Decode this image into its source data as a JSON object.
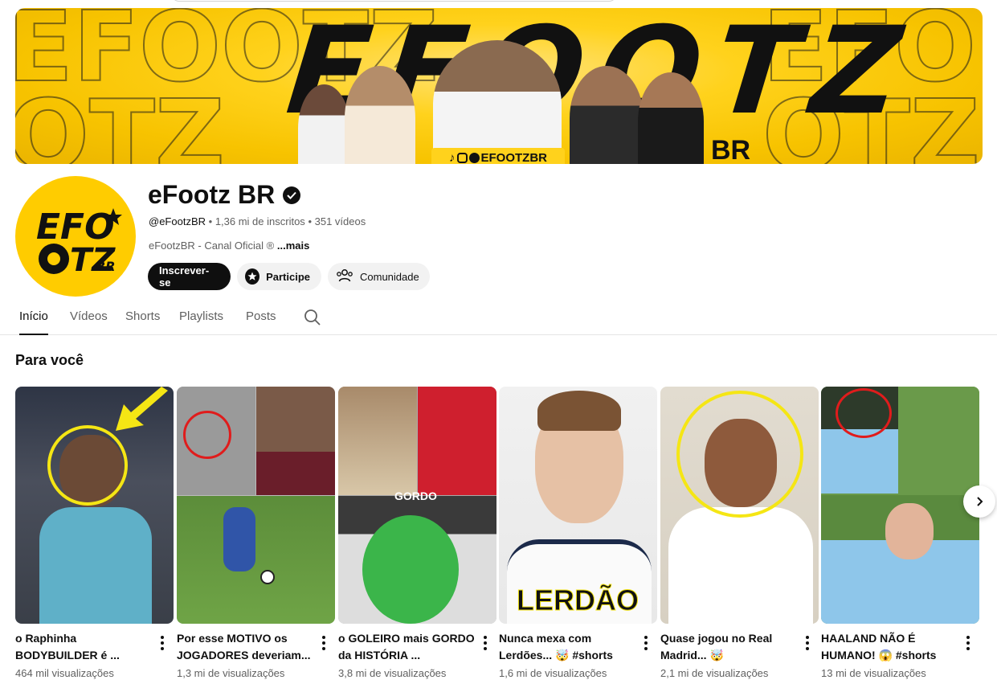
{
  "banner": {
    "title": "EFOOTZ",
    "subtitle": "BR",
    "social_handle": "EFOOTZBR",
    "bg_text": "EFOOTZ"
  },
  "channel": {
    "name": "eFootz BR",
    "handle": "@eFootzBR",
    "subscribers": "1,36 mi de inscritos",
    "videos": "351 vídeos",
    "separator": "•",
    "description": "eFootzBR - Canal Oficial ®",
    "more_label": "...mais",
    "avatar_text_1": "EFO",
    "avatar_text_2": "TZ",
    "avatar_text_3": "BR"
  },
  "actions": {
    "subscribe": "Inscrever-se",
    "join": "Participe",
    "community": "Comunidade"
  },
  "tabs": [
    {
      "label": "Início"
    },
    {
      "label": "Vídeos"
    },
    {
      "label": "Shorts"
    },
    {
      "label": "Playlists"
    },
    {
      "label": "Posts"
    }
  ],
  "section": {
    "title": "Para você"
  },
  "videos": [
    {
      "title": "o Raphinha BODYBUILDER é ...",
      "views": "464 mil visualizações"
    },
    {
      "title": "Por esse MOTIVO os JOGADORES deveriam...",
      "views": "1,3 mi de visualizações"
    },
    {
      "title": "o GOLEIRO mais GORDO da HISTÓRIA ...",
      "views": "3,8 mi de visualizações",
      "overlay": "GORDO"
    },
    {
      "title": "Nunca mexa com Lerdões... 🤯 #shorts",
      "views": "1,6 mi de visualizações",
      "overlay": "LERDÃO"
    },
    {
      "title": "Quase jogou no Real Madrid... 🤯",
      "views": "2,1 mi de visualizações"
    },
    {
      "title": "HAALAND NÃO É HUMANO! 😱 #shorts",
      "views": "13 mi de visualizações"
    }
  ],
  "colors": {
    "brand_yellow": "#ffd21c",
    "circle_yellow": "#f5e614",
    "circle_red": "#e01c1c"
  }
}
